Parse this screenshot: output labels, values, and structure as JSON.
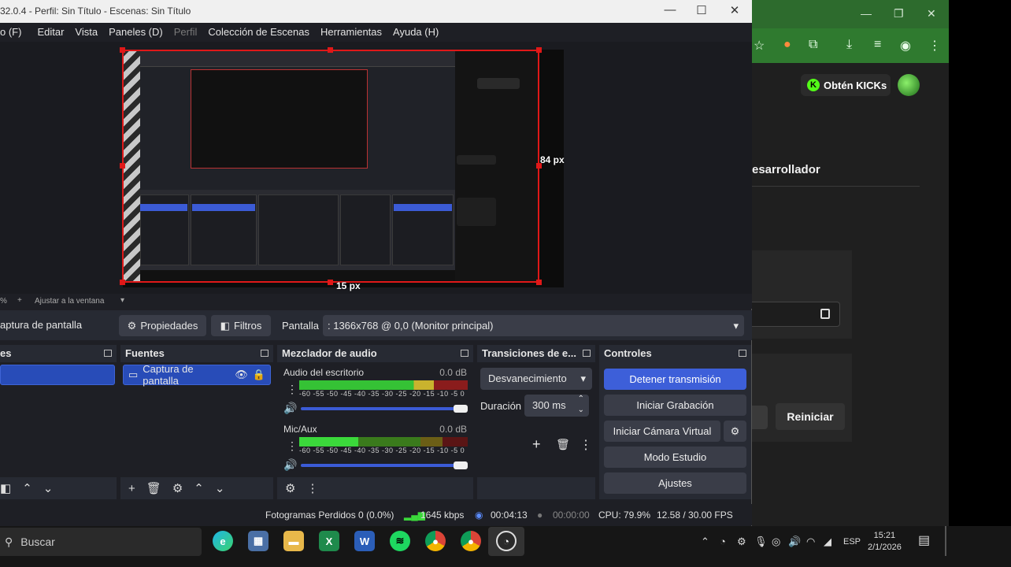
{
  "obs": {
    "window_title": "32.0.4 - Perfil: Sin Título - Escenas: Sin Título",
    "menu": [
      "o (F)",
      "Editar",
      "Vista",
      "Paneles (D)",
      "Perfil",
      "Colección de Escenas",
      "Herramientas",
      "Ayuda (H)"
    ],
    "preview": {
      "px_right": "84 px",
      "px_bottom": "15 px",
      "zoom_pct": "%",
      "fit_label": "Ajustar a la ventana"
    },
    "source_bar": {
      "source_name": "aptura de pantalla",
      "properties_label": "Propiedades",
      "filters_label": "Filtros",
      "display_label": "Pantalla",
      "display_value": ": 1366x768 @ 0,0 (Monitor principal)"
    },
    "docks": {
      "scenes_title": "es",
      "sources_title": "Fuentes",
      "source_item": "Captura de pantalla",
      "mixer_title": "Mezclador de audio",
      "transitions_title": "Transiciones de e...",
      "controls_title": "Controles"
    },
    "mixer": {
      "channels": [
        {
          "name": "Audio del escritorio",
          "db": "0.0 dB"
        },
        {
          "name": "Mic/Aux",
          "db": "0.0 dB"
        }
      ],
      "scale": "-60 -55 -50 -45 -40 -35 -30 -25 -20 -15 -10 -5 0"
    },
    "transitions": {
      "type": "Desvanecimiento",
      "duration_label": "Duración",
      "duration_value": "300 ms"
    },
    "controls": {
      "stop_stream": "Detener transmisión",
      "start_recording": "Iniciar Grabación",
      "start_virtual_camera": "Iniciar Cámara Virtual",
      "studio_mode": "Modo Estudio",
      "settings": "Ajustes"
    },
    "status": {
      "dropped_frames": "Fotogramas Perdidos 0 (0.0%)",
      "bitrate": "1645 kbps",
      "stream_time": "00:04:13",
      "rec_time": "00:00:00",
      "cpu": "CPU: 79.9%",
      "fps": "12.58 / 30.00 FPS"
    }
  },
  "browser": {
    "kick_button": "Obtén KICKs",
    "dev_title": "esarrollador",
    "restart_button": "Reiniciar"
  },
  "taskbar": {
    "search_label": "Buscar",
    "lang": "ESP",
    "time": "15:21",
    "date": "2/1/2026"
  },
  "colors": {
    "accent_blue": "#3d5fd9",
    "selection_red": "#e01818",
    "kick_green": "#53fc18"
  }
}
